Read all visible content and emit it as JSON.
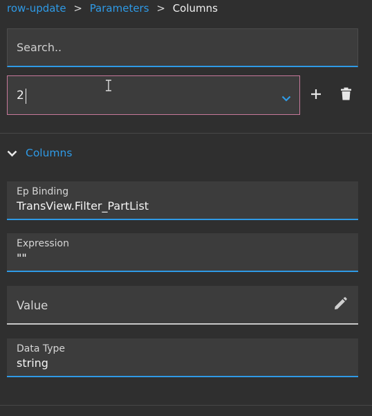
{
  "breadcrumb": {
    "items": [
      "row-update",
      "Parameters",
      "Columns"
    ],
    "separator": ">"
  },
  "search": {
    "placeholder": "Search..",
    "value": ""
  },
  "selector": {
    "value": "2"
  },
  "section": {
    "label": "Columns",
    "expanded": true
  },
  "fields": {
    "ep_binding": {
      "label": "Ep Binding",
      "value": "TransView.Filter_PartList"
    },
    "expression": {
      "label": "Expression",
      "value": "\"\""
    },
    "value": {
      "label": "Value",
      "value": ""
    },
    "data_type": {
      "label": "Data Type",
      "value": "string"
    }
  },
  "icons": {
    "add": "plus-icon",
    "delete": "trash-icon",
    "dropdown": "chevron-down-icon",
    "section_toggle": "chevron-down-icon",
    "edit": "pencil-icon"
  },
  "colors": {
    "accent": "#2f9ae6",
    "background": "#2f2f2f",
    "field_bg": "#3c3c3c",
    "selected_border": "#c7799b"
  }
}
